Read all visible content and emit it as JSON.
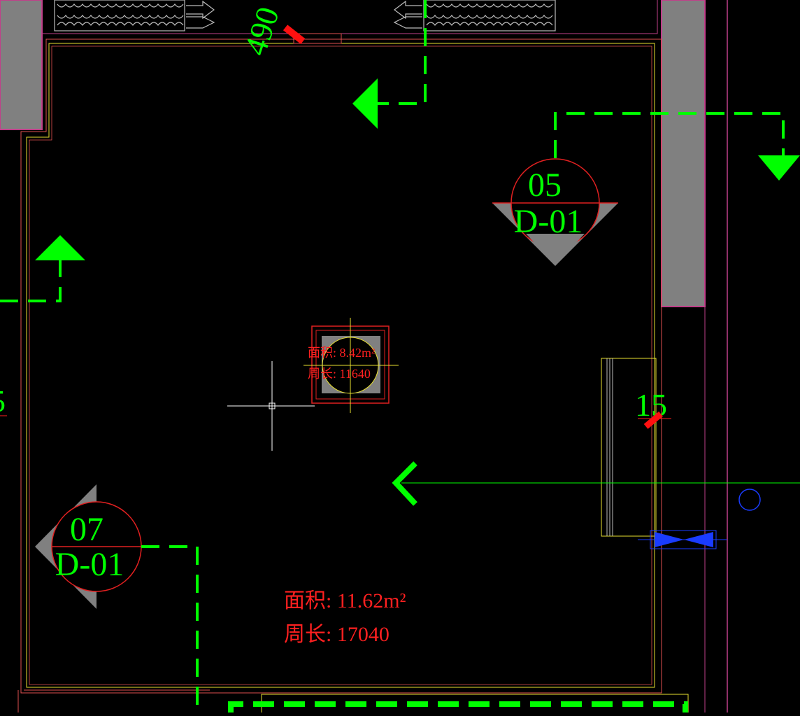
{
  "colors": {
    "background": "#000000",
    "wall_outline": "#e05050",
    "inner_outline": "#e8e030",
    "annotation_green": "#00ff00",
    "area_text_red": "#ff2020",
    "column_gray": "#808080",
    "wall_magenta": "#c0408a",
    "crosshair": "#ffffff",
    "blue_symbol": "#1a3cff"
  },
  "elevation_markers": {
    "marker_05": {
      "number": "05",
      "sheet": "D-01"
    },
    "marker_07": {
      "number": "07",
      "sheet": "D-01"
    }
  },
  "dimensions": {
    "top_dimension": "490",
    "side_dimension": "15",
    "left_partial": "5"
  },
  "area_label_small": {
    "area": "面积: 8.42m²",
    "perimeter": "周长: 11640"
  },
  "area_label_main": {
    "area": "面积: 11.62m²",
    "perimeter": "周长: 17040"
  }
}
